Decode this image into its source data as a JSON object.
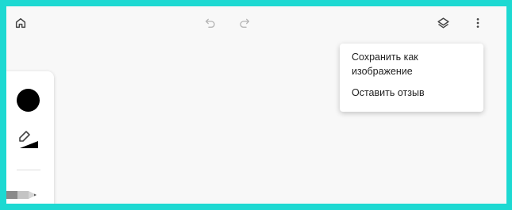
{
  "toolbar": {
    "home_icon": "home-icon",
    "undo_icon": "undo-icon",
    "redo_icon": "redo-icon",
    "layers_icon": "layers-icon",
    "more_icon": "more-vert-icon"
  },
  "tool_panel": {
    "color": "#000000",
    "stroke_icon": "stroke-width-icon",
    "pencil_icon": "pencil-icon"
  },
  "menu": {
    "items": [
      {
        "label": "Сохранить как изображение"
      },
      {
        "label": "Оставить отзыв"
      }
    ]
  },
  "colors": {
    "frame_border": "#1dd9d2",
    "canvas_bg": "#f8f8f8",
    "icon_active": "#4a4a4a",
    "icon_disabled": "#b5b5b5"
  }
}
